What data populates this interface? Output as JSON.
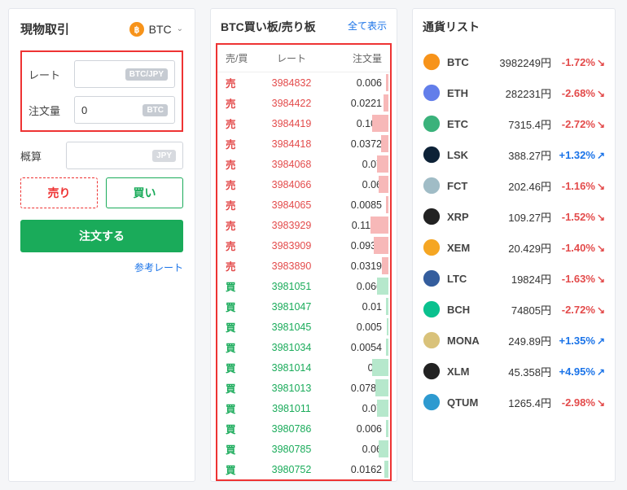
{
  "trade": {
    "title": "現物取引",
    "coin": "BTC",
    "rate_label": "レート",
    "rate_unit": "BTC/JPY",
    "qty_label": "注文量",
    "qty_value": "0",
    "qty_unit": "BTC",
    "est_label": "概算",
    "est_unit": "JPY",
    "sell_btn": "売り",
    "buy_btn": "買い",
    "order_btn": "注文する",
    "ref_link": "参考レート"
  },
  "orderbook": {
    "title": "BTC買い板/売り板",
    "showall": "全て表示",
    "h1": "売/買",
    "h2": "レート",
    "h3": "注文量",
    "sell_label": "売",
    "buy_label": "買",
    "sells": [
      {
        "rate": "3984832",
        "qty": "0.006",
        "depth": 3
      },
      {
        "rate": "3984422",
        "qty": "0.0221",
        "depth": 6
      },
      {
        "rate": "3984419",
        "qty": "0.106",
        "depth": 20
      },
      {
        "rate": "3984418",
        "qty": "0.0372",
        "depth": 9
      },
      {
        "rate": "3984068",
        "qty": "0.07",
        "depth": 14
      },
      {
        "rate": "3984066",
        "qty": "0.06",
        "depth": 12
      },
      {
        "rate": "3984065",
        "qty": "0.0085",
        "depth": 3
      },
      {
        "rate": "3983929",
        "qty": "0.1124",
        "depth": 22
      },
      {
        "rate": "3983909",
        "qty": "0.0935",
        "depth": 18
      },
      {
        "rate": "3983890",
        "qty": "0.0319",
        "depth": 8
      }
    ],
    "buys": [
      {
        "rate": "3981051",
        "qty": "0.066",
        "depth": 14
      },
      {
        "rate": "3981047",
        "qty": "0.01",
        "depth": 3
      },
      {
        "rate": "3981045",
        "qty": "0.005",
        "depth": 2
      },
      {
        "rate": "3981034",
        "qty": "0.0054",
        "depth": 3
      },
      {
        "rate": "3981014",
        "qty": "0.1",
        "depth": 20
      },
      {
        "rate": "3981013",
        "qty": "0.0786",
        "depth": 16
      },
      {
        "rate": "3981011",
        "qty": "0.07",
        "depth": 14
      },
      {
        "rate": "3980786",
        "qty": "0.006",
        "depth": 3
      },
      {
        "rate": "3980785",
        "qty": "0.06",
        "depth": 12
      },
      {
        "rate": "3980752",
        "qty": "0.0162",
        "depth": 5
      }
    ]
  },
  "currencies": {
    "title": "通貨リスト",
    "items": [
      {
        "sym": "BTC",
        "price": "3982249円",
        "change": "-1.72%",
        "dir": "neg",
        "color": "#f7931a"
      },
      {
        "sym": "ETH",
        "price": "282231円",
        "change": "-2.68%",
        "dir": "neg",
        "color": "#627eea"
      },
      {
        "sym": "ETC",
        "price": "7315.4円",
        "change": "-2.72%",
        "dir": "neg",
        "color": "#3ab27b"
      },
      {
        "sym": "LSK",
        "price": "388.27円",
        "change": "+1.32%",
        "dir": "pos",
        "color": "#0d2237"
      },
      {
        "sym": "FCT",
        "price": "202.46円",
        "change": "-1.16%",
        "dir": "neg",
        "color": "#a0bcc6"
      },
      {
        "sym": "XRP",
        "price": "109.27円",
        "change": "-1.52%",
        "dir": "neg",
        "color": "#222"
      },
      {
        "sym": "XEM",
        "price": "20.429円",
        "change": "-1.40%",
        "dir": "neg",
        "color": "#f5a623"
      },
      {
        "sym": "LTC",
        "price": "19824円",
        "change": "-1.63%",
        "dir": "neg",
        "color": "#345d9d"
      },
      {
        "sym": "BCH",
        "price": "74805円",
        "change": "-2.72%",
        "dir": "neg",
        "color": "#0ac18e"
      },
      {
        "sym": "MONA",
        "price": "249.89円",
        "change": "+1.35%",
        "dir": "pos",
        "color": "#d9c27a"
      },
      {
        "sym": "XLM",
        "price": "45.358円",
        "change": "+4.95%",
        "dir": "pos",
        "color": "#222"
      },
      {
        "sym": "QTUM",
        "price": "1265.4円",
        "change": "-2.98%",
        "dir": "neg",
        "color": "#2e9ad0"
      }
    ]
  }
}
